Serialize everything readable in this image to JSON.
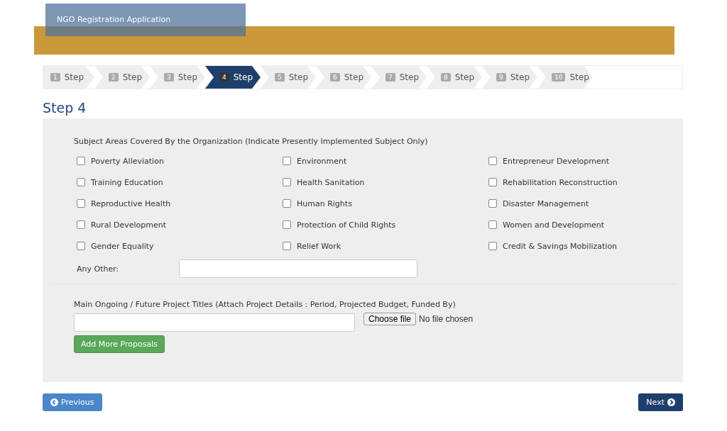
{
  "header": {
    "title": "NGO Registration Application"
  },
  "steps": [
    {
      "number": "1",
      "label": "Step",
      "selected": false
    },
    {
      "number": "2",
      "label": "Step",
      "selected": false
    },
    {
      "number": "3",
      "label": "Step",
      "selected": false
    },
    {
      "number": "4",
      "label": "Step",
      "selected": true
    },
    {
      "number": "5",
      "label": "Step",
      "selected": false
    },
    {
      "number": "6",
      "label": "Step",
      "selected": false
    },
    {
      "number": "7",
      "label": "Step",
      "selected": false
    },
    {
      "number": "8",
      "label": "Step",
      "selected": false
    },
    {
      "number": "9",
      "label": "Step",
      "selected": false
    },
    {
      "number": "10",
      "label": "Step",
      "selected": false
    }
  ],
  "heading": "Step 4",
  "subjects": {
    "label": "Subject Areas Covered By the Organization (Indicate Presently Implemented Subject Only)",
    "options": [
      {
        "label": "Poverty Alleviation",
        "checked": false
      },
      {
        "label": "Environment",
        "checked": false
      },
      {
        "label": "Entrepreneur Development",
        "checked": false
      },
      {
        "label": "Training Education",
        "checked": false
      },
      {
        "label": "Health Sanitation",
        "checked": false
      },
      {
        "label": "Rehabilitation Reconstruction",
        "checked": false
      },
      {
        "label": "Reproductive Health",
        "checked": false
      },
      {
        "label": "Human Rights",
        "checked": false
      },
      {
        "label": "Disaster Management",
        "checked": false
      },
      {
        "label": "Rural Development",
        "checked": false
      },
      {
        "label": "Protection of Child Rights",
        "checked": false
      },
      {
        "label": "Women and Development",
        "checked": false
      },
      {
        "label": "Gender Equality",
        "checked": false
      },
      {
        "label": "Relief Work",
        "checked": false
      },
      {
        "label": "Credit & Savings Mobilization",
        "checked": false
      }
    ],
    "other_label": "Any Other:"
  },
  "projects": {
    "label": "Main Ongoing / Future Project Titles (Attach Project Details : Period, Projected Budget, Funded By)",
    "file_button": "Choose file",
    "file_status": "No file chosen",
    "add_button": "Add More Proposals"
  },
  "nav": {
    "previous": "Previous",
    "next": "Next"
  }
}
